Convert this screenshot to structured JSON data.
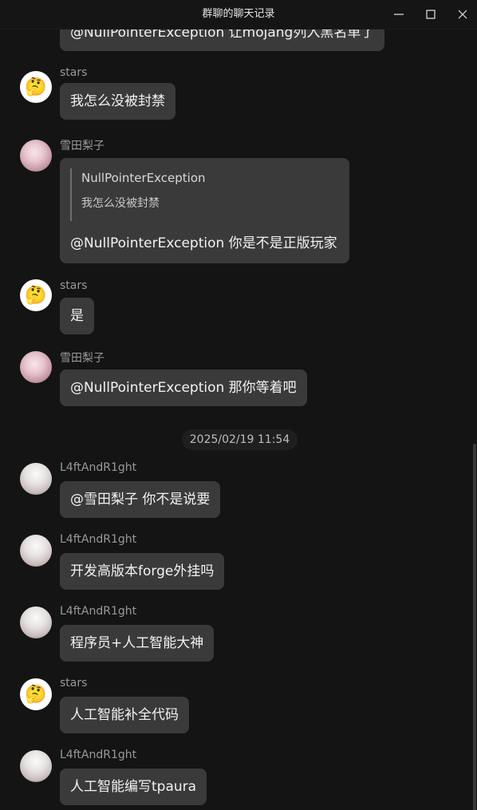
{
  "window": {
    "title": "群聊的聊天记录",
    "controls": {
      "minimize": "minimize-icon",
      "maximize": "maximize-icon",
      "close": "close-icon"
    }
  },
  "messages": [
    {
      "sender": "",
      "text": "@NullPointerException 让mojang列入黑名单了",
      "partial": true
    },
    {
      "sender": "stars",
      "avatar": "thinking-emoji",
      "text": "我怎么没被封禁"
    },
    {
      "sender": "雪田梨子",
      "avatar": "anime-girl-pink",
      "quote": {
        "author": "NullPointerException",
        "text": "我怎么没被封禁"
      },
      "text": "@NullPointerException 你是不是正版玩家"
    },
    {
      "sender": "stars",
      "avatar": "thinking-emoji",
      "text": "是"
    },
    {
      "sender": "雪田梨子",
      "avatar": "anime-girl-pink",
      "text": "@NullPointerException 那你等着吧"
    },
    {
      "sender": "L4ftAndR1ght",
      "avatar": "anime-girl-white",
      "text": "@雪田梨子 你不是说要"
    },
    {
      "sender": "L4ftAndR1ght",
      "avatar": "anime-girl-white",
      "text": "开发高版本forge外挂吗"
    },
    {
      "sender": "L4ftAndR1ght",
      "avatar": "anime-girl-white",
      "text": "程序员+人工智能大神"
    },
    {
      "sender": "stars",
      "avatar": "thinking-emoji",
      "text": "人工智能补全代码"
    },
    {
      "sender": "L4ftAndR1ght",
      "avatar": "anime-girl-white",
      "text": "人工智能编写tpaura"
    }
  ],
  "timestamp": "2025/02/19 11:54",
  "emoji": "🤔",
  "colors": {
    "background": "#141414",
    "bubble": "#3a3a3a",
    "sender": "#9a9a9a"
  }
}
